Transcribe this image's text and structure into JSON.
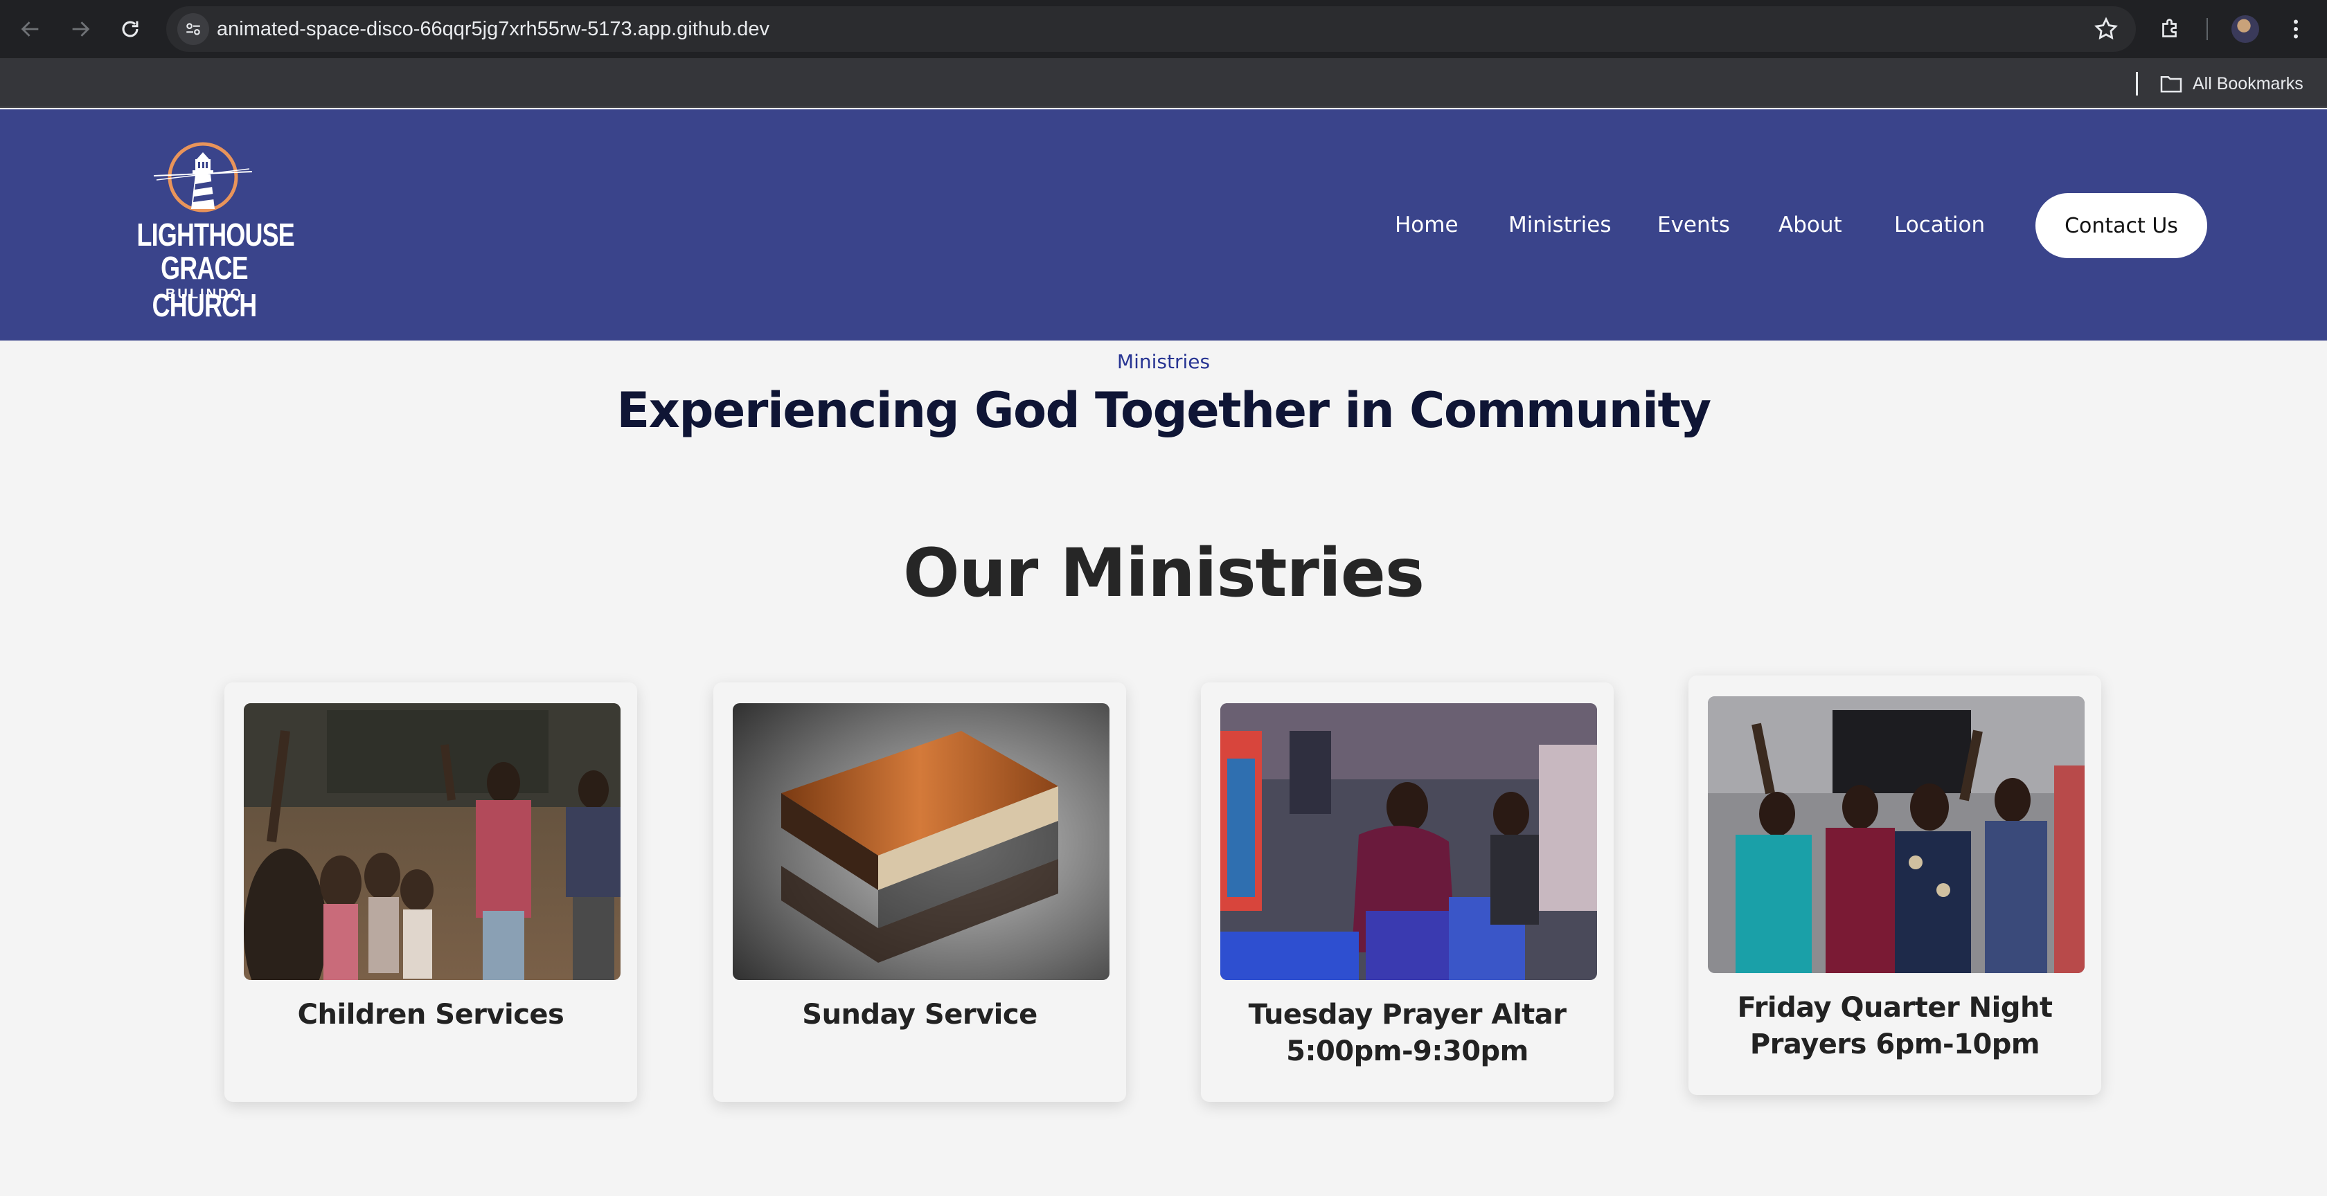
{
  "browser": {
    "url": "animated-space-disco-66qqr5jg7xrh55rw-5173.app.github.dev",
    "bookmarks_label": "All Bookmarks"
  },
  "logo": {
    "line1": "LIGHTHOUSE",
    "line2": "GRACE CHURCH",
    "line3": "BULINDO"
  },
  "nav": {
    "items": [
      {
        "label": "Home"
      },
      {
        "label": "Ministries"
      },
      {
        "label": "Events"
      },
      {
        "label": "About"
      },
      {
        "label": "Location"
      }
    ],
    "contact_label": "Contact Us"
  },
  "hero": {
    "eyebrow": "Ministries",
    "headline": "Experiencing God Together in Community"
  },
  "ministries": {
    "title": "Our Ministries",
    "cards": [
      {
        "line1": "Children Services",
        "line2": ""
      },
      {
        "line1": "Sunday Service",
        "line2": ""
      },
      {
        "line1": "Tuesday Prayer Altar",
        "line2": "5:00pm-9:30pm"
      },
      {
        "line1": "Friday Quarter Night",
        "line2": "Prayers 6pm-10pm"
      }
    ]
  },
  "colors": {
    "header_bg": "#3a448b",
    "eyebrow": "#283593",
    "headline": "#0f1535",
    "page_bg": "#f4f4f4"
  }
}
